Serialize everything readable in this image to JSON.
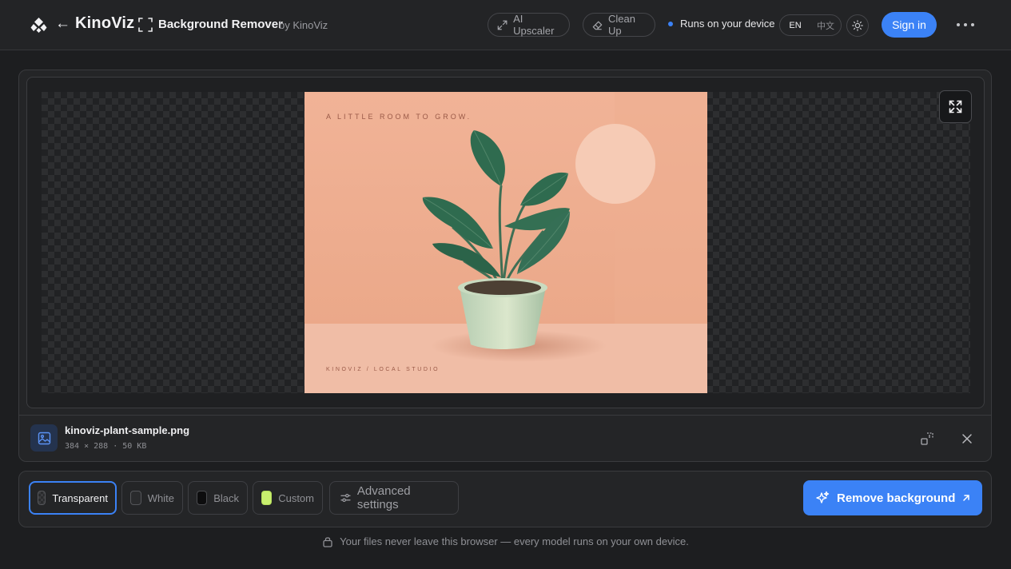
{
  "header": {
    "brand": "KinoViz",
    "back_arrow": "←",
    "tool_title": "Background Remover",
    "by_line": "by KinoViz",
    "nav": {
      "ai_upscaler": "AI Upscaler",
      "clean_up": "Clean Up"
    },
    "device_status": "Runs on your device",
    "languages": [
      "EN",
      "中文"
    ],
    "active_language": "EN",
    "sign_in": "Sign in",
    "icons": {
      "logo": "kinoviz-logo-icon",
      "tool": "focus-frame-icon",
      "upscaler": "expand-arrows-icon",
      "cleanup": "eraser-icon",
      "theme": "sun-icon",
      "more": "more-horizontal-icon"
    }
  },
  "preview": {
    "image_text_top": "A LITTLE ROOM TO GROW.",
    "image_text_bottom": "KINOVIZ / LOCAL STUDIO",
    "expand_icon": "fullscreen-icon"
  },
  "file": {
    "name": "kinoviz-plant-sample.png",
    "meta": "384 × 288 · 50 KB",
    "icons": {
      "thumb": "image-icon",
      "compare": "compare-icon",
      "close": "close-icon"
    }
  },
  "toolbar": {
    "background_options": [
      {
        "label": "Transparent",
        "active": true
      },
      {
        "label": "White",
        "active": false
      },
      {
        "label": "Black",
        "active": false
      },
      {
        "label": "Custom",
        "active": false,
        "color": "#c8ef6e"
      }
    ],
    "advanced_settings": "Advanced settings",
    "remove_background": "Remove background"
  },
  "footer": {
    "note": "Your files never leave this browser — every model runs on your own device.",
    "icon": "lock-icon"
  },
  "colors": {
    "accent": "#3b82f6",
    "background": "#1d1e20",
    "panel": "#242527",
    "image_bg": "#eeaa8a"
  }
}
